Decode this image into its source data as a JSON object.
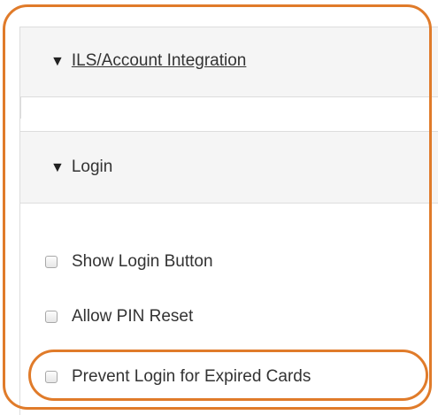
{
  "colors": {
    "highlight": "#e07b2a",
    "header_bg": "#f5f5f5",
    "border": "#dddddd",
    "text": "#333333"
  },
  "sections": {
    "ils": {
      "caret": "▼",
      "title": "ILS/Account Integration"
    },
    "login": {
      "caret": "▼",
      "title": "Login",
      "options": [
        {
          "label": "Show Login Button",
          "checked": false
        },
        {
          "label": "Allow PIN Reset",
          "checked": false
        },
        {
          "label": "Prevent Login for Expired Cards",
          "checked": false
        }
      ]
    }
  }
}
